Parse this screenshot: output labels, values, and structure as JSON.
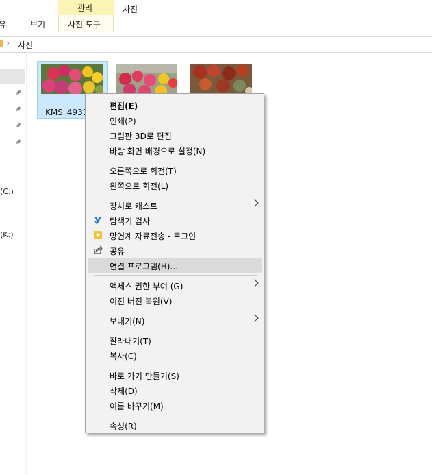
{
  "ribbon": {
    "tabs": [
      "유",
      "보기",
      "사진 도구"
    ],
    "context_group": "관리",
    "context_tab": "사진"
  },
  "address": {
    "path": "사진"
  },
  "nav": {
    "drives": [
      "(C:)",
      "(K:)"
    ]
  },
  "thumbnails": [
    {
      "name": "KMS_4931",
      "selected": true
    },
    {
      "name": "",
      "selected": false
    },
    {
      "name": "",
      "selected": false
    }
  ],
  "menu": {
    "groups": [
      [
        {
          "label": "편집(E)",
          "bold": true
        },
        {
          "label": "인쇄(P)"
        },
        {
          "label": "그림판 3D로 편집"
        },
        {
          "label": "바탕 화면 배경으로 설정(N)"
        }
      ],
      [
        {
          "label": "오른쪽으로 회전(T)"
        },
        {
          "label": "왼쪽으로 회전(L)"
        }
      ],
      [
        {
          "label": "장치로 캐스트",
          "submenu": true
        },
        {
          "label": "탐색기 검사",
          "icon": "defender-icon"
        },
        {
          "label": "망연계 자료전송 - 로그인",
          "icon": "transfer-icon"
        },
        {
          "label": "공유",
          "icon": "share-icon"
        },
        {
          "label": "연결 프로그램(H)...",
          "highlighted": true
        }
      ],
      [
        {
          "label": "액세스 권한 부여 (G)",
          "submenu": true
        },
        {
          "label": "이전 버전 복원(V)"
        }
      ],
      [
        {
          "label": "보내기(N)",
          "submenu": true
        }
      ],
      [
        {
          "label": "잘라내기(T)"
        },
        {
          "label": "복사(C)"
        }
      ],
      [
        {
          "label": "바로 가기 만들기(S)"
        },
        {
          "label": "삭제(D)"
        },
        {
          "label": "이름 바꾸기(M)"
        }
      ],
      [
        {
          "label": "속성(R)"
        }
      ]
    ]
  },
  "colors": {
    "context_band": "#fbf4b5",
    "selection": "#cce8ff",
    "menu_bg": "#f2f2f2",
    "menu_highlight": "#dadada"
  }
}
